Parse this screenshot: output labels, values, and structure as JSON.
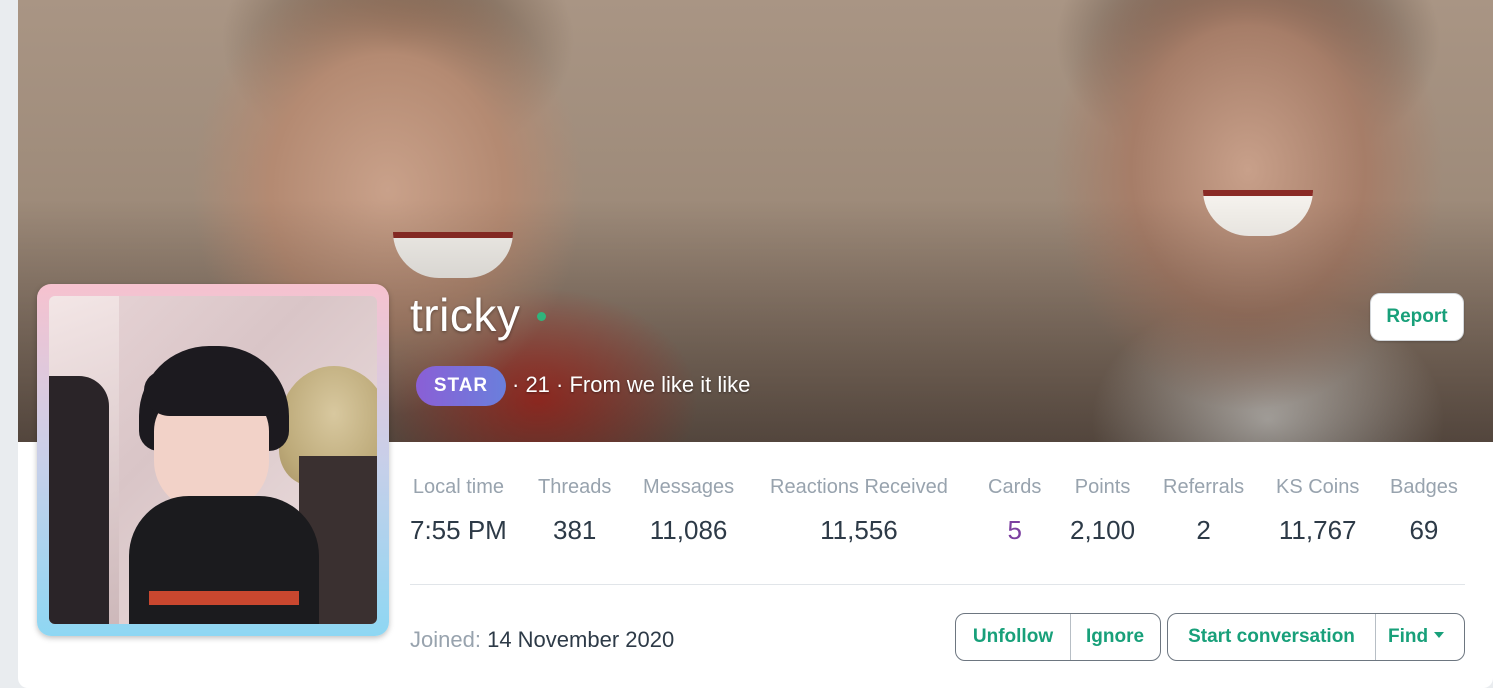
{
  "profile": {
    "username": "tricky",
    "status": "online",
    "banner": "cover-photo",
    "avatar": "profile-photo",
    "rank_badge": "STAR",
    "meta": "· 21 · From we like it like",
    "report_label": "Report"
  },
  "stats": [
    {
      "label": "Local time",
      "value": "7:55 PM"
    },
    {
      "label": "Threads",
      "value": "381"
    },
    {
      "label": "Messages",
      "value": "11,086"
    },
    {
      "label": "Reactions Received",
      "value": "11,556"
    },
    {
      "label": "Cards",
      "value": "5"
    },
    {
      "label": "Points",
      "value": "2,100"
    },
    {
      "label": "Referrals",
      "value": "2"
    },
    {
      "label": "KS Coins",
      "value": "11,767"
    },
    {
      "label": "Badges",
      "value": "69"
    }
  ],
  "joined": {
    "label": "Joined:",
    "date": "14 November 2020"
  },
  "actions": {
    "unfollow": "Unfollow",
    "ignore": "Ignore",
    "start_conversation": "Start conversation",
    "find": "Find"
  },
  "colors": {
    "accent": "#18a07a",
    "cards_value": "#7b3fa0",
    "star_badge_start": "#8a5fd6",
    "star_badge_end": "#6a7fdc",
    "online": "#2fb47c"
  }
}
